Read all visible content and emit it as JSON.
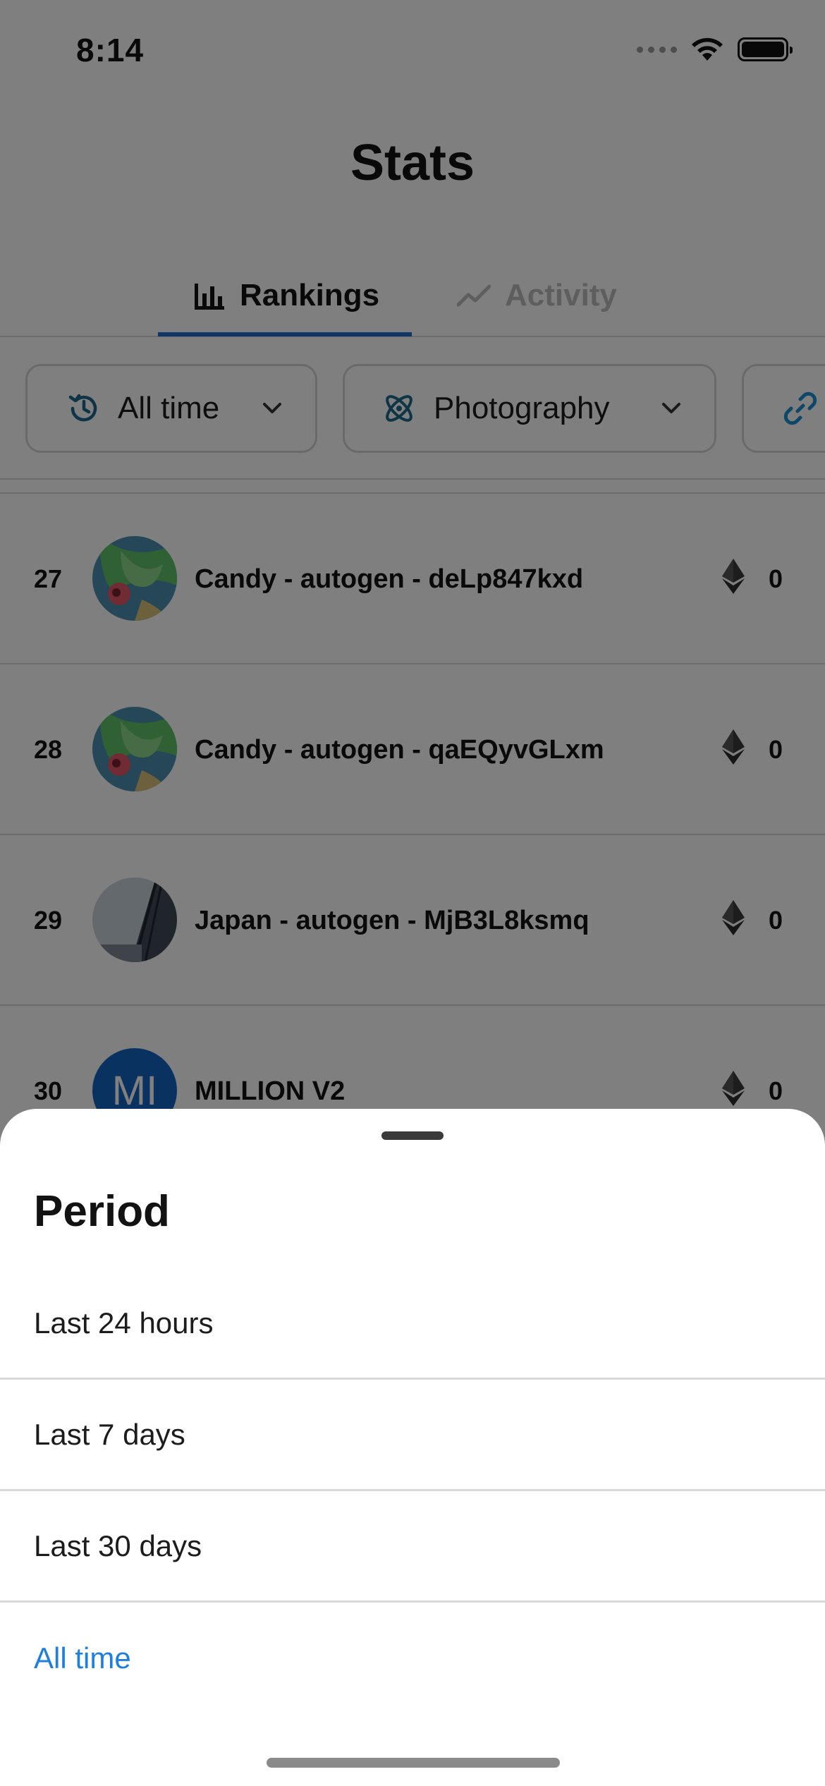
{
  "status_bar": {
    "time": "8:14"
  },
  "header": {
    "title": "Stats"
  },
  "tabs": [
    {
      "label": "Rankings",
      "active": true
    },
    {
      "label": "Activity",
      "active": false
    }
  ],
  "filters": {
    "time": {
      "label": "All time"
    },
    "category": {
      "label": "Photography"
    }
  },
  "rankings": [
    {
      "rank": "27",
      "name": "Candy - autogen - deLp847kxd",
      "volume": "0",
      "avatar": "candy-art"
    },
    {
      "rank": "28",
      "name": "Candy - autogen - qaEQyvGLxm",
      "volume": "0",
      "avatar": "candy-art"
    },
    {
      "rank": "29",
      "name": "Japan - autogen - MjB3L8ksmq",
      "volume": "0",
      "avatar": "japan-photo"
    },
    {
      "rank": "30",
      "name": "MILLION V2",
      "volume": "0",
      "avatar_initials": "MI"
    }
  ],
  "period_sheet": {
    "title": "Period",
    "options": [
      {
        "label": "Last 24 hours",
        "selected": false
      },
      {
        "label": "Last 7 days",
        "selected": false
      },
      {
        "label": "Last 30 days",
        "selected": false
      },
      {
        "label": "All time",
        "selected": true
      }
    ]
  },
  "colors": {
    "accent": "#1e7fdc",
    "tab_indicator": "#1f6fcf",
    "overlay": "rgba(0,0,0,0.5)"
  },
  "icons": [
    "bar-chart-icon",
    "trend-icon",
    "history-icon",
    "atom-icon",
    "link-icon",
    "chevron-down-icon",
    "ethereum-icon"
  ]
}
